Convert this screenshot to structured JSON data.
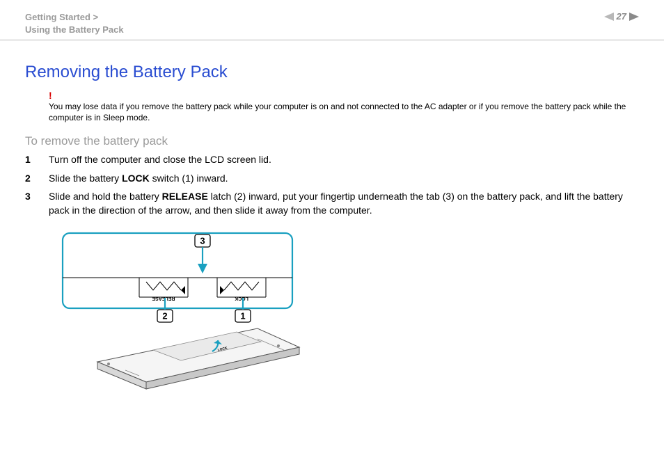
{
  "header": {
    "breadcrumb_line1": "Getting Started >",
    "breadcrumb_line2": "Using the Battery Pack",
    "page_number": "27"
  },
  "page": {
    "title": "Removing the Battery Pack",
    "warning_mark": "!",
    "warning_text": "You may lose data if you remove the battery pack while your computer is on and not connected to the AC adapter or if you remove the battery pack while the computer is in Sleep mode.",
    "subtitle": "To remove the battery pack",
    "steps": [
      {
        "pre": "Turn off the computer and close the LCD screen lid."
      },
      {
        "pre": "Slide the battery ",
        "bold": "LOCK",
        "post": " switch (1) inward."
      },
      {
        "pre": "Slide and hold the battery ",
        "bold": "RELEASE",
        "post": " latch (2) inward, put your fingertip underneath the tab (3) on the battery pack, and lift the battery pack in the direction of the arrow, and then slide it away from the computer."
      }
    ],
    "diagram": {
      "callout_1": "1",
      "callout_2": "2",
      "callout_3": "3",
      "label_lock": "LOCK",
      "label_release": "RELEASE"
    }
  }
}
